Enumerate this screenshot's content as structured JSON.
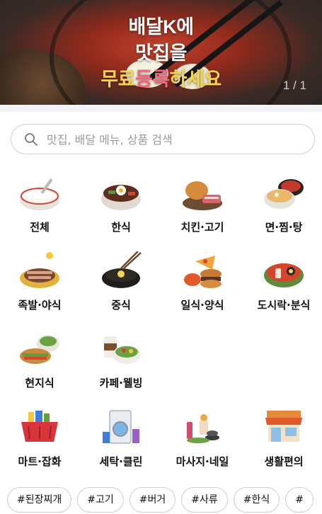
{
  "banner": {
    "line1": "배달K에",
    "line2": "맛집을",
    "line3_a": "무료",
    "line3_b": "등록",
    "line3_c": "하세요",
    "pager": "1 / 1"
  },
  "search": {
    "placeholder": "맛집, 배달 메뉴, 상품 검색"
  },
  "categories": [
    {
      "label": "전체",
      "icon": "rice-bowl-icon"
    },
    {
      "label": "한식",
      "icon": "bibimbap-icon"
    },
    {
      "label": "치킨·고기",
      "icon": "chicken-meat-icon"
    },
    {
      "label": "면·찜·탕",
      "icon": "noodle-soup-icon"
    },
    {
      "label": "족발·야식",
      "icon": "jokbal-icon"
    },
    {
      "label": "중식",
      "icon": "chinese-food-icon"
    },
    {
      "label": "일식·양식",
      "icon": "sushi-burger-icon"
    },
    {
      "label": "도시락·분식",
      "icon": "tteokbokki-icon"
    },
    {
      "label": "현지식",
      "icon": "sandwich-icon"
    },
    {
      "label": "카페·웰빙",
      "icon": "coffee-salad-icon"
    },
    {
      "label": "마트·잡화",
      "icon": "basket-icon"
    },
    {
      "label": "세탁·클린",
      "icon": "washing-machine-icon"
    },
    {
      "label": "마사지·네일",
      "icon": "spa-icon"
    },
    {
      "label": "생활편의",
      "icon": "store-icon"
    }
  ],
  "tags": [
    "#된장찌개",
    "#고기",
    "#버거",
    "#사류",
    "#한식",
    "#"
  ]
}
